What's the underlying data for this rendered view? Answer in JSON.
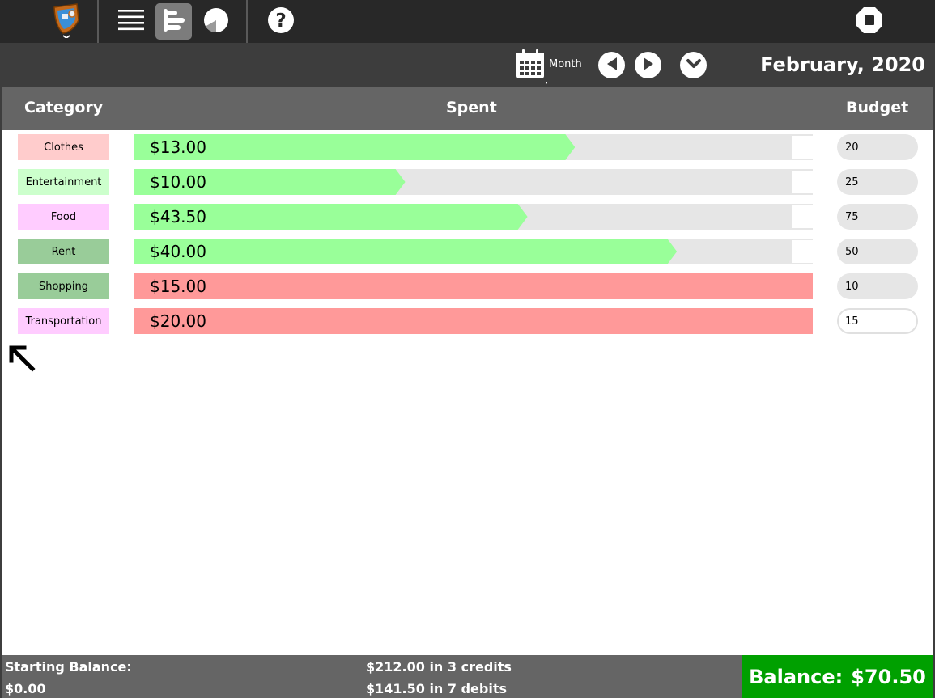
{
  "toolbar": {
    "logo_icon": "app-logo-icon",
    "list_icon": "hamburger-list-icon",
    "bar_chart_icon": "bar-chart-icon",
    "pie_chart_icon": "pie-chart-icon",
    "help_icon": "help-icon",
    "stop_icon": "stop-icon"
  },
  "period": {
    "calendar_icon": "calendar-icon",
    "mode_label": "Month",
    "title": "February, 2020"
  },
  "table": {
    "headers": {
      "category": "Category",
      "spent": "Spent",
      "budget": "Budget"
    },
    "rows": [
      {
        "category": "Clothes",
        "color": "#ffcccc",
        "spent": "$13.00",
        "budget": "20",
        "progress": 0.65,
        "over": false
      },
      {
        "category": "Entertainment",
        "color": "#ccffcc",
        "spent": "$10.00",
        "budget": "25",
        "progress": 0.4,
        "over": false
      },
      {
        "category": "Food",
        "color": "#ffccff",
        "spent": "$43.50",
        "budget": "75",
        "progress": 0.58,
        "over": false
      },
      {
        "category": "Rent",
        "color": "#99cc99",
        "spent": "$40.00",
        "budget": "50",
        "progress": 0.8,
        "over": false
      },
      {
        "category": "Shopping",
        "color": "#99cc99",
        "spent": "$15.00",
        "budget": "10",
        "progress": 1.0,
        "over": true
      },
      {
        "category": "Transportation",
        "color": "#ffccff",
        "spent": "$20.00",
        "budget": "15",
        "progress": 1.0,
        "over": true
      }
    ]
  },
  "footer": {
    "starting_balance_label": "Starting Balance:",
    "starting_balance_value": "$0.00",
    "credits": "$212.00 in 3 credits",
    "debits": "$141.50 in 7 debits",
    "balance_label": "Balance:",
    "balance_value": "$70.50"
  },
  "colors": {
    "under_budget": "#99ff99",
    "over_budget": "#ff9999",
    "balance_positive": "#00a000"
  }
}
